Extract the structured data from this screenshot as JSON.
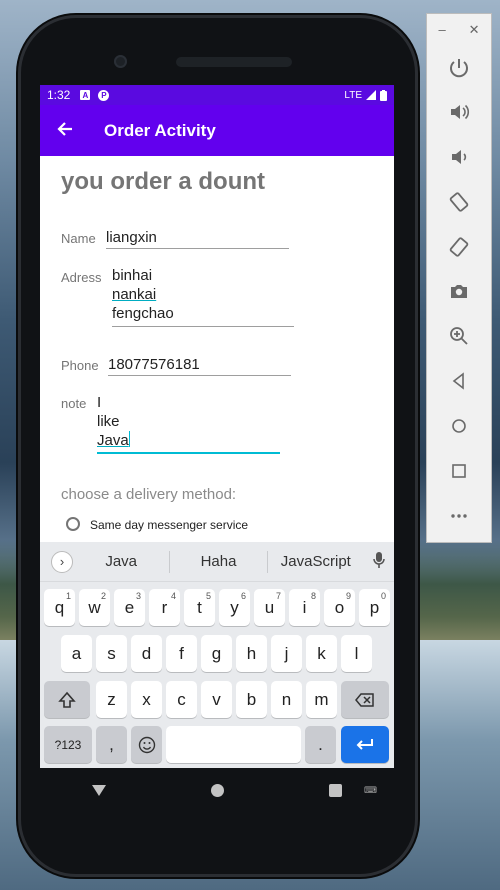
{
  "status_bar": {
    "time": "1:32",
    "icon_a": "A",
    "icon_p": "P",
    "network": "LTE"
  },
  "app_bar": {
    "title": "Order Activity"
  },
  "form": {
    "heading": "you order a dount",
    "name_label": "Name",
    "name_value": "liangxin",
    "address_label": "Adress",
    "address_lines": [
      "binhai",
      "nankai",
      "fengchao"
    ],
    "phone_label": "Phone",
    "phone_value": "18077576181",
    "note_label": "note",
    "note_lines": [
      "I",
      "like",
      "Java"
    ],
    "delivery_prompt": "choose a delivery method:",
    "delivery_option_1": "Same day messenger service"
  },
  "keyboard": {
    "suggestions": [
      "Java",
      "Haha",
      "JavaScript"
    ],
    "row1": [
      {
        "k": "q",
        "n": "1"
      },
      {
        "k": "w",
        "n": "2"
      },
      {
        "k": "e",
        "n": "3"
      },
      {
        "k": "r",
        "n": "4"
      },
      {
        "k": "t",
        "n": "5"
      },
      {
        "k": "y",
        "n": "6"
      },
      {
        "k": "u",
        "n": "7"
      },
      {
        "k": "i",
        "n": "8"
      },
      {
        "k": "o",
        "n": "9"
      },
      {
        "k": "p",
        "n": "0"
      }
    ],
    "row2": [
      "a",
      "s",
      "d",
      "f",
      "g",
      "h",
      "j",
      "k",
      "l"
    ],
    "row3": [
      "z",
      "x",
      "c",
      "v",
      "b",
      "n",
      "m"
    ],
    "symbols_key": "?123",
    "comma_key": ",",
    "period_key": "."
  },
  "icons": {
    "back": "arrow-left-icon",
    "mic": "microphone-icon",
    "shift": "shift-icon",
    "backspace": "backspace-icon",
    "emoji": "emoji-icon",
    "enter": "enter-icon"
  },
  "colors": {
    "status_bar": "#5a0ae0",
    "app_bar": "#6200ee",
    "focus": "#00bcd4",
    "enter_key": "#1a73e8"
  }
}
